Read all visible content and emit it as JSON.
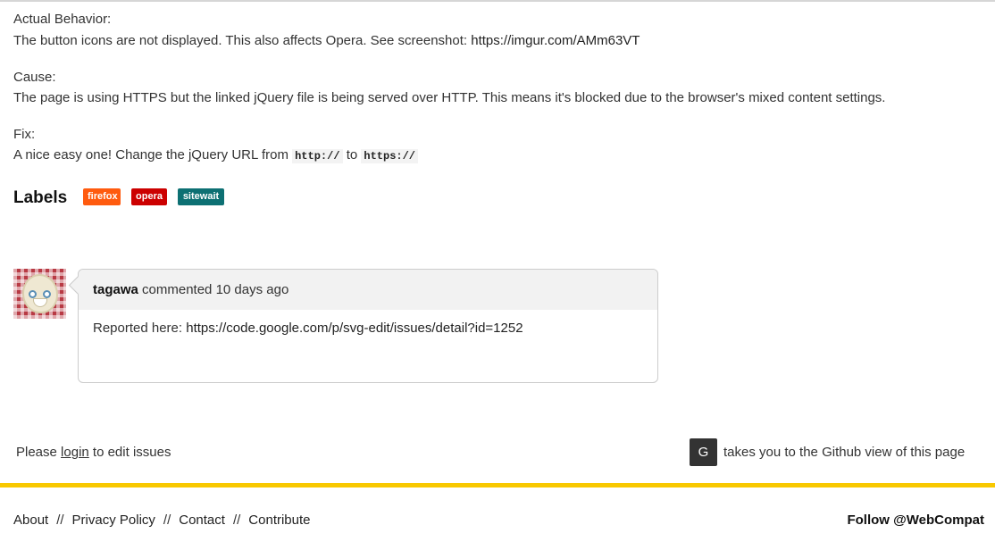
{
  "issue": {
    "actual_behavior_heading": "Actual Behavior:",
    "actual_behavior_text": "The button icons are not displayed. This also affects Opera. See screenshot: ",
    "actual_behavior_link": "https://imgur.com/AMm63VT",
    "cause_heading": "Cause:",
    "cause_text": "The page is using HTTPS but the linked jQuery file is being served over HTTP. This means it's blocked due to the browser's mixed content settings.",
    "fix_heading": "Fix:",
    "fix_text_before": "A nice easy one! Change the jQuery URL from ",
    "fix_code_from": "http://",
    "fix_text_mid": " to ",
    "fix_code_to": "https://"
  },
  "labels": {
    "heading": "Labels",
    "items": [
      {
        "text": "firefox",
        "color": "#ff5b0f"
      },
      {
        "text": "opera",
        "color": "#cc0000"
      },
      {
        "text": "sitewait",
        "color": "#0d7073"
      }
    ]
  },
  "comment": {
    "author": "tagawa",
    "action": " commented 10 days ago",
    "body_prefix": "Reported here: ",
    "body_link": "https://code.google.com/p/svg-edit/issues/detail?id=1252"
  },
  "footer_note": {
    "please": "Please ",
    "login_link": "login",
    "to_edit": " to edit issues",
    "key": "G",
    "github_text": "takes you to the Github view of this page"
  },
  "footer": {
    "links": [
      "About",
      "Privacy Policy",
      "Contact",
      "Contribute"
    ],
    "separator": "//",
    "follow": "Follow @WebCompat"
  },
  "colors": {
    "accent_yellow": "#f8c800"
  }
}
